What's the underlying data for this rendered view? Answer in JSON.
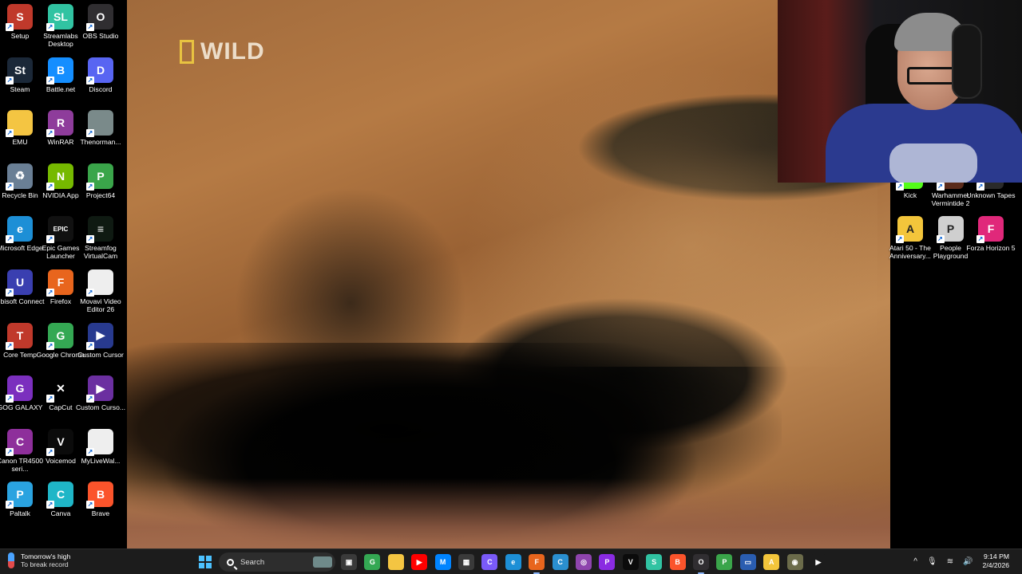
{
  "desktop_left": [
    {
      "label": "Setup",
      "icon": "wolf-icon",
      "color": "#c0392b",
      "glyph": "S"
    },
    {
      "label": "Streamlabs Desktop",
      "icon": "streamlabs-icon",
      "color": "#31c3a2",
      "glyph": "SL"
    },
    {
      "label": "OBS Studio",
      "icon": "obs-icon",
      "color": "#302e31",
      "glyph": "O"
    },
    {
      "label": "Steam",
      "icon": "steam-icon",
      "color": "#1b2838",
      "glyph": "St"
    },
    {
      "label": "Battle.net",
      "icon": "battlenet-icon",
      "color": "#148eff",
      "glyph": "B"
    },
    {
      "label": "Discord",
      "icon": "discord-icon",
      "color": "#5865f2",
      "glyph": "D"
    },
    {
      "label": "EMU",
      "icon": "folder-icon",
      "color": "#f4c542",
      "glyph": ""
    },
    {
      "label": "WinRAR",
      "icon": "winrar-icon",
      "color": "#8e3c9b",
      "glyph": "R"
    },
    {
      "label": "Thenorman...",
      "icon": "image-icon",
      "color": "#7a8a8a",
      "glyph": ""
    },
    {
      "label": "Recycle Bin",
      "icon": "recycle-bin-icon",
      "color": "#6a7f95",
      "glyph": "♻"
    },
    {
      "label": "NVIDIA App",
      "icon": "nvidia-icon",
      "color": "#76b900",
      "glyph": "N"
    },
    {
      "label": "Project64",
      "icon": "project64-icon",
      "color": "#3aa54a",
      "glyph": "P"
    },
    {
      "label": "Microsoft Edge",
      "icon": "edge-icon",
      "color": "#1d8fd6",
      "glyph": "e"
    },
    {
      "label": "Epic Games Launcher",
      "icon": "epic-icon",
      "color": "#111111",
      "glyph": "EPIC"
    },
    {
      "label": "Streamfog VirtualCam",
      "icon": "streamfog-icon",
      "color": "#0f1a12",
      "glyph": "≡"
    },
    {
      "label": "Ubisoft Connect",
      "icon": "ubisoft-icon",
      "color": "#3a3fb0",
      "glyph": "U"
    },
    {
      "label": "Firefox",
      "icon": "firefox-icon",
      "color": "#e8651d",
      "glyph": "F"
    },
    {
      "label": "Movavi Video Editor 26",
      "icon": "document-icon",
      "color": "#eeeeee",
      "glyph": ""
    },
    {
      "label": "Core Temp",
      "icon": "thermometer-icon",
      "color": "#c0392b",
      "glyph": "T"
    },
    {
      "label": "Google Chrome",
      "icon": "chrome-icon",
      "color": "#34a853",
      "glyph": "G"
    },
    {
      "label": "Custom Cursor",
      "icon": "cursor-icon",
      "color": "#283a8f",
      "glyph": "▶"
    },
    {
      "label": "GOG GALAXY",
      "icon": "gog-icon",
      "color": "#7b2fbe",
      "glyph": "G"
    },
    {
      "label": "CapCut",
      "icon": "capcut-icon",
      "color": "#000000",
      "glyph": "✕"
    },
    {
      "label": "Custom Curso...",
      "icon": "cursor-icon",
      "color": "#6b2fa0",
      "glyph": "▶"
    },
    {
      "label": "Canon TR4500 seri...",
      "icon": "printer-icon",
      "color": "#8e2f9b",
      "glyph": "C"
    },
    {
      "label": "Voicemod",
      "icon": "voicemod-icon",
      "color": "#0b0b0b",
      "glyph": "V"
    },
    {
      "label": "MyLiveWal...",
      "icon": "document-icon",
      "color": "#eeeeee",
      "glyph": ""
    },
    {
      "label": "Paltalk",
      "icon": "paltalk-icon",
      "color": "#2aa3e0",
      "glyph": "P"
    },
    {
      "label": "Canva",
      "icon": "canva-icon",
      "color": "#1fb6c7",
      "glyph": "C"
    },
    {
      "label": "Brave",
      "icon": "brave-icon",
      "color": "#fb542b",
      "glyph": "B"
    }
  ],
  "desktop_right": [
    {
      "label": "Kick",
      "icon": "kick-icon",
      "color": "#53fc18",
      "glyph": "K"
    },
    {
      "label": "Warhammer Vermintide 2",
      "icon": "warhammer-icon",
      "color": "#5a2a1a",
      "glyph": "W"
    },
    {
      "label": "Unknown Tapes",
      "icon": "tape-icon",
      "color": "#2a2a2a",
      "glyph": "UT"
    },
    {
      "label": "Atari 50 - The Anniversary...",
      "icon": "atari-icon",
      "color": "#f3c53b",
      "glyph": "A"
    },
    {
      "label": "People Playground",
      "icon": "people-playground-icon",
      "color": "#cfcfcf",
      "glyph": "P"
    },
    {
      "label": "Forza Horizon 5",
      "icon": "forza-icon",
      "color": "#e0287a",
      "glyph": "F"
    }
  ],
  "video": {
    "watermark": "WILD"
  },
  "taskbar": {
    "weather_line1": "Tomorrow's high",
    "weather_line2": "To break record",
    "search_placeholder": "Search",
    "apps": [
      {
        "name": "task-view-icon",
        "color": "#3a3a3a",
        "glyph": "▣"
      },
      {
        "name": "chrome-icon",
        "color": "#34a853",
        "glyph": "G"
      },
      {
        "name": "file-explorer-icon",
        "color": "#f4c542",
        "glyph": ""
      },
      {
        "name": "youtube-icon",
        "color": "#ff0000",
        "glyph": "▶"
      },
      {
        "name": "messenger-icon",
        "color": "#0084ff",
        "glyph": "M"
      },
      {
        "name": "store-icon",
        "color": "#3a3a3a",
        "glyph": "▦"
      },
      {
        "name": "copilot-icon",
        "color": "#7a5af8",
        "glyph": "C"
      },
      {
        "name": "edge-icon",
        "color": "#1d8fd6",
        "glyph": "e"
      },
      {
        "name": "firefox-icon",
        "color": "#e8651d",
        "glyph": "F"
      },
      {
        "name": "cortana-icon",
        "color": "#2a8fd0",
        "glyph": "C"
      },
      {
        "name": "app-icon",
        "color": "#8e44ad",
        "glyph": "◎"
      },
      {
        "name": "pixel-icon",
        "color": "#8a2be2",
        "glyph": "P"
      },
      {
        "name": "voicemod-icon",
        "color": "#0b0b0b",
        "glyph": "V"
      },
      {
        "name": "streamlabs-icon",
        "color": "#31c3a2",
        "glyph": "S"
      },
      {
        "name": "brave-icon",
        "color": "#fb542b",
        "glyph": "B"
      },
      {
        "name": "obs-icon",
        "color": "#302e31",
        "glyph": "O"
      },
      {
        "name": "project64-icon",
        "color": "#3aa54a",
        "glyph": "P"
      },
      {
        "name": "app-window-icon",
        "color": "#2a5db0",
        "glyph": "▭"
      },
      {
        "name": "atari-icon",
        "color": "#f3c53b",
        "glyph": "A"
      },
      {
        "name": "xbox-icon",
        "color": "#6b6b4a",
        "glyph": "◉"
      },
      {
        "name": "cursor-icon",
        "color": "#1c1c1c",
        "glyph": "▶"
      }
    ],
    "tray": {
      "chevron": "^",
      "mic": "🎙",
      "wifi": "≋",
      "volume": "🔊"
    },
    "time": "9:14 PM",
    "date": "2/4/2026"
  }
}
